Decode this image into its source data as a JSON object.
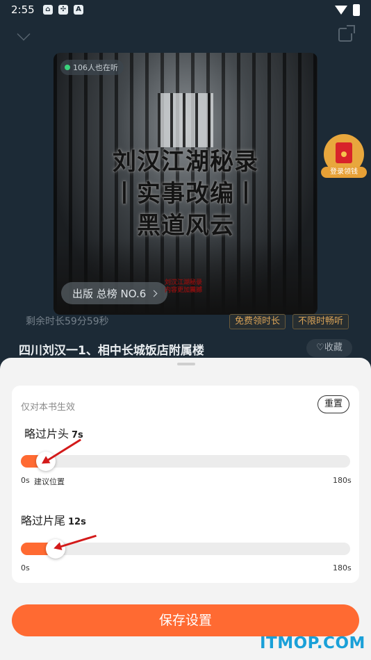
{
  "status_bar": {
    "time": "2:55",
    "notif_icons": [
      "home-shield-icon",
      "pinwheel-icon",
      "a-box-icon"
    ]
  },
  "player": {
    "listeners": "106人也在听",
    "cover_title_lines": [
      "刘汉江湖秘录",
      "丨实事改编丨",
      "黑道风云"
    ],
    "cover_note": [
      "刘汉江湖秘录",
      "内容更加震撼"
    ],
    "rank": "出版 总榜 NO.6",
    "redpacket_label": "登录领钱",
    "remaining": "剩余时长59分59秒",
    "free_badge": "免费领时长",
    "unlimited_badge": "不限时畅听",
    "book_title": "四川刘汉一1、相中长城饭店附属楼",
    "collect": "收藏"
  },
  "settings": {
    "hint": "仅对本书生效",
    "reset": "重置",
    "intro": {
      "label": "略过片头",
      "value": "7s",
      "min": "0s",
      "suggest": "建议位置",
      "max": "180s",
      "fraction": 0.039
    },
    "outro": {
      "label": "略过片尾",
      "value": "12s",
      "min": "0s",
      "max": "180s",
      "fraction": 0.067
    },
    "save": "保存设置"
  },
  "watermark": "ITMOP.COM",
  "colors": {
    "accent": "#ff6a32",
    "bg_dark": "#1c2a36",
    "gold": "#d8a257"
  }
}
